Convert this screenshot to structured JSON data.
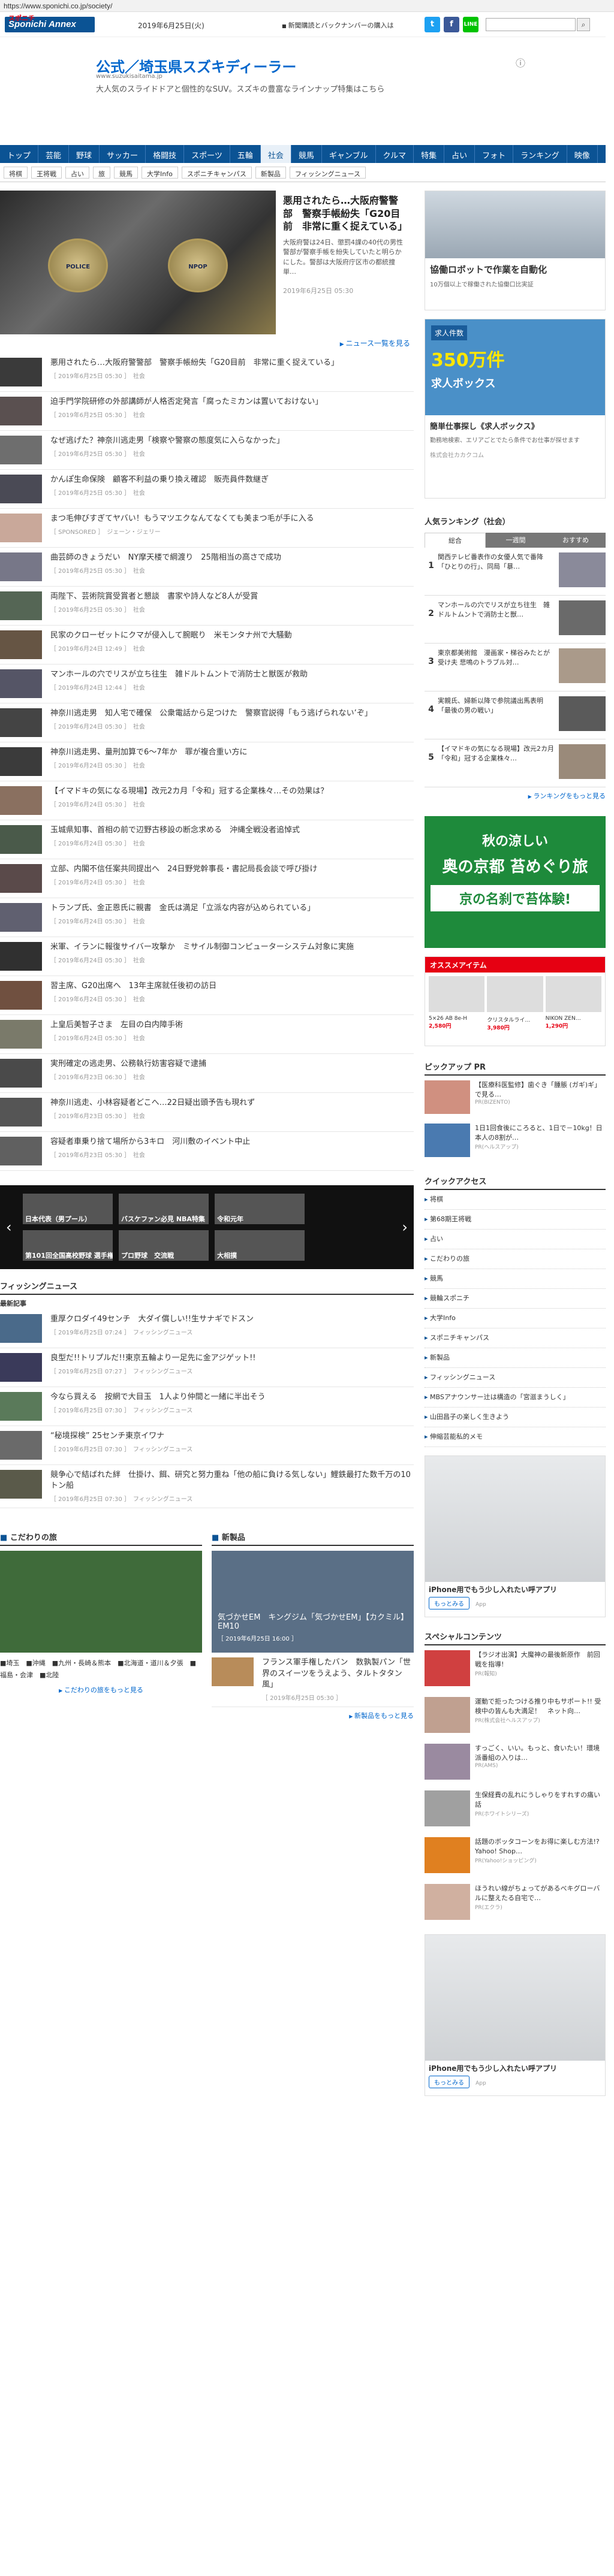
{
  "url": "https://www.sponichi.co.jp/society/",
  "header": {
    "logo_kanji": "スポニチ",
    "logo": "Sponichi Annex",
    "date": "2019年6月25日(火)",
    "notice": "新聞購読とバックナンバーの購入は",
    "search_placeholder": ""
  },
  "banner": {
    "title": "公式／埼玉県スズキディーラー",
    "url": "www.suzukisaitama.jp",
    "desc": "大人気のスライドドアと個性的なSUV。スズキの豊富なラインナップ特集はこちら"
  },
  "nav": [
    "トップ",
    "芸能",
    "野球",
    "サッカー",
    "格闘技",
    "スポーツ",
    "五輪",
    "社会",
    "競馬",
    "ギャンブル",
    "クルマ",
    "特集",
    "占い",
    "フォト",
    "ランキング",
    "映像"
  ],
  "nav_active": 7,
  "subnav": [
    "将棋",
    "王将戦",
    "占い",
    "旅",
    "競馬",
    "大学Info",
    "スポニチキャンパス",
    "新製品",
    "フィッシングニュース"
  ],
  "hero": {
    "title": "悪用されたら…大阪府警警部　警察手帳紛失「G20目前　非常に重く捉えている」",
    "desc": "大阪府警は24日、懲罰4課の40代の男性警部が警察手帳を紛失していたと明らかにした。警部は大阪府庁区市の都統捜単…",
    "date": "2019年6月25日 05:30",
    "badge1": "POLICE",
    "badge2": "NPOP"
  },
  "hero_more": "ニュース一覧を見る",
  "articles": [
    {
      "title": "悪用されたら…大阪府警警部　警察手帳紛失「G20目前　非常に重く捉えている」",
      "meta": "［ 2019年6月25日 05:30 ］　社会"
    },
    {
      "title": "迫手門学院研修の外部講師が人格否定発言「腐ったミカンは置いておけない」",
      "meta": "［ 2019年6月25日 05:30 ］　社会"
    },
    {
      "title": "なぜ逃げた？神奈川逃走男「検察や警察の態度気に入らなかった」",
      "meta": "［ 2019年6月25日 05:30 ］　社会"
    },
    {
      "title": "かんぽ生命保険　顧客不利益の乗り換え確認　販売員件数継ぎ",
      "meta": "［ 2019年6月25日 05:30 ］　社会"
    },
    {
      "title": "まつ毛伸びすぎてヤバい！もうマツエクなんてなくても美まつ毛が手に入る",
      "meta": "［ SPONSORED ］　ジェーン・ジェリー"
    },
    {
      "title": "曲芸師のきょうだい　NY摩天楼で綱渡り　25階相当の高さで成功",
      "meta": "［ 2019年6月25日 05:30 ］　社会"
    },
    {
      "title": "両陛下、芸術院賞受賞者と懇談　書家や詩人など8人が受賞",
      "meta": "［ 2019年6月25日 05:30 ］　社会"
    },
    {
      "title": "民家のクローゼットにクマが侵入して腕眠り　米モンタナ州で大騒動",
      "meta": "［ 2019年6月24日 12:49 ］　社会"
    },
    {
      "title": "マンホールの穴でリスが立ち往生　雑ドルトムントで消防士と獣医が救助",
      "meta": "［ 2019年6月24日 12:44 ］　社会"
    },
    {
      "title": "神奈川逃走男　知人宅で確保　公衆電話から足つけた　警察官説得「もう逃げられない’ぞ」",
      "meta": "［ 2019年6月24日 05:30 ］　社会"
    },
    {
      "title": "神奈川逃走男、量刑加算で6～7年か　罪が複合重い方に",
      "meta": "［ 2019年6月24日 05:30 ］　社会"
    },
    {
      "title": "【イマドキの気になる現場】改元2カ月「令和」冠する企業株々…その効果は？",
      "meta": "［ 2019年6月24日 05:30 ］　社会"
    },
    {
      "title": "玉城県知事、首相の前で辺野古移設の断念求める　沖縄全戦没者追悼式",
      "meta": "［ 2019年6月24日 05:30 ］　社会"
    },
    {
      "title": "立部、内閣不信任案共同提出へ　24日野党幹事長・書記局長会談で呼び掛け",
      "meta": "［ 2019年6月24日 05:30 ］　社会"
    },
    {
      "title": "トランプ氏、金正恩氏に親書　金氏は満足「立派な内容が込められている」",
      "meta": "［ 2019年6月24日 05:30 ］　社会"
    },
    {
      "title": "米軍、イランに報復サイバー攻撃か　ミサイル制御コンピューターシステム対象に実施",
      "meta": "［ 2019年6月24日 05:30 ］　社会"
    },
    {
      "title": "習主席、G20出席へ　13年主席就任後初の訪日",
      "meta": "［ 2019年6月24日 05:30 ］　社会"
    },
    {
      "title": "上皇后美智子さま　左目の白内障手術",
      "meta": "［ 2019年6月24日 05:30 ］　社会"
    },
    {
      "title": "実刑確定の逃走男、公務執行妨害容疑で逮捕",
      "meta": "［ 2019年6月23日 06:30 ］　社会"
    },
    {
      "title": "神奈川逃走、小林容疑者どこへ…22日疑出頭予告も現れず",
      "meta": "［ 2019年6月23日 05:30 ］　社会"
    },
    {
      "title": "容疑者車乗り捨て場所から3キロ　河川敷のイベント中止",
      "meta": "［ 2019年6月23日 05:30 ］　社会"
    }
  ],
  "carousel": {
    "prev": "‹",
    "next": "›",
    "cells": [
      "日本代表（男プール）",
      "バスケファン必見 NBA特集",
      "令和元年",
      "第101回全国高校野球 選手権大会各地区結果",
      "プロ野球　交流戦",
      "大相撲"
    ]
  },
  "fishing": {
    "title": "フィッシングニュース",
    "sub": "最新記事",
    "items": [
      {
        "title": "重厚クロダイ49センチ　大ダイ償しい!!生サナギでドスン",
        "meta": "［ 2019年6月25日 07:24 ］　フィッシングニュース"
      },
      {
        "title": "良型だ!!トリプルだ!!東京五輪より一足先に金アジゲット!!",
        "meta": "［ 2019年6月25日 07:27 ］　フィッシングニュース"
      },
      {
        "title": "今なら買える　按網で大目玉　1人より仲間と一緒に半出そう",
        "meta": "［ 2019年6月25日 07:30 ］　フィッシングニュース"
      },
      {
        "title": "“秘境探検” 25センチ東京イワナ",
        "meta": "［ 2019年6月25日 07:30 ］　フィッシングニュース"
      },
      {
        "title": "競争心で結ばれた絆　仕掛け、餌、研究と努力重ね「他の船に負ける気しない」鯉鉄最打た数千万の10トン船",
        "meta": "［ 2019年6月25日 07:30 ］　フィッシングニュース"
      }
    ]
  },
  "travel": {
    "title": "こだわりの旅",
    "regions": "■埼玉　■沖縄　■九州・長崎＆熊本　■北海道・道川＆夕張　■福島・会津　■北陸",
    "link": "こだわりの旅をもっと見る"
  },
  "newprod": {
    "title": "新製品",
    "img_caption": "気づかせEM　キングジム「気づかせEM」【カクミル】EM10",
    "date": "［ 2019年6月25日 16:00 ］",
    "item": "フランス軍手権したバン　数孰製パン「世界のスイーツをうえよう、タルトタタン風」",
    "item_meta": "［ 2019年6月25日 05:30 ］",
    "link": "新製品をもっと見る"
  },
  "side": {
    "robot_title": "協働ロボットで作業を自動化",
    "robot_sub": "10万個以上で稼働された協働口比実証",
    "job_count": "求人件数",
    "job_big": "350万件",
    "job_brand": "求人ボックス",
    "job_title": "簡単仕事探し《求人ボックス》",
    "job_desc": "勤務地検索、エリアごとでたら条件でお仕事が探せます",
    "job_foot": "株式会社カカクコム",
    "rank_title": "人気ランキング（社会）",
    "rank_tabs": [
      "総合",
      "一週間",
      "おすすめ"
    ],
    "rank_items": [
      "関西テレビ番表作の女優人気で番降「ひとりの行」、同局「暴…",
      "マンホールの穴でリスが立ち往生　雑ドルトムントで消防士と獣…",
      "東京都美術館　漫画家・梯谷みたとが受け夫 悲鳴のトラブル対…",
      "実親氏、婦新以降で参院議出馬表明「最後の男の戦い」",
      "【イマドキの気になる現場】改元2カ月「令和」冠する企業株々…"
    ],
    "rank_more": "ランキングをもっと見る",
    "kyoto": [
      "秋の涼しい",
      "奥の京都 苔めぐり旅",
      "京の名刹で苔体験!"
    ],
    "osusume_title": "オススメアイテム",
    "osusume_items": [
      {
        "name": "5×26 AB 8e-H",
        "price": "2,580円"
      },
      {
        "name": "クリスタルライ…",
        "price": "3,980円"
      },
      {
        "name": "NIKON ZEN…",
        "price": "1,290円"
      }
    ],
    "pr_title": "ピックアップ PR",
    "pr_items": [
      {
        "text": "【医療科医監修】歯ぐき「腫脹 (ガギ)ギ」で見る…",
        "src": "PR(BIZENTO)"
      },
      {
        "text": "1日1回食後にころると、1日で－10kg！日本人の8割が…",
        "src": "PR(ヘルスアップ)"
      }
    ],
    "qa_title": "クイックアクセス",
    "qa_items": [
      "将棋",
      "第68期王将戦",
      "占い",
      "こだわりの旅",
      "競馬",
      "競輪スポニチ",
      "大学Info",
      "スポニチキャンパス",
      "新製品",
      "フィッシングニュース",
      "MBSアナウンサー辻は構造の「宮滋まうしく」",
      "山田昌子の楽しく生きよう",
      "伸縮芸能私的メモ"
    ],
    "phone_title": "iPhone用でもう少し入れたい呼アプリ",
    "phone_btn": "もっとみる",
    "phone_src": "App",
    "sp_title": "スペシャルコンテンツ",
    "sp_items": [
      {
        "text": "【ラジオ出演】大魔神の最後新原作　前回戦を指導!",
        "src": "PR(報知)"
      },
      {
        "text": "運動で拒ったつける推り中もサポート!! 受検中の皆んも大満足！　ネット向…",
        "src": "PR(株式会社ヘルスアップ)"
      },
      {
        "text": "すっごく、いい。もっと、食いたい！環境派番組の入りは…",
        "src": "PR(AMS)"
      },
      {
        "text": "生保経費の乱れにうしゃりをすれすの痛い話",
        "src": "PR(ホワイトシリーズ)"
      },
      {
        "text": "話題のボッタコーンをお得に楽しむ方法!?Yahoo! Shop…",
        "src": "PR(Yahoo!ショッピング)"
      },
      {
        "text": "ほうれい線がちょってがあるべキグローバルに整えたる自宅で…",
        "src": "PR(エクラ)"
      }
    ]
  }
}
